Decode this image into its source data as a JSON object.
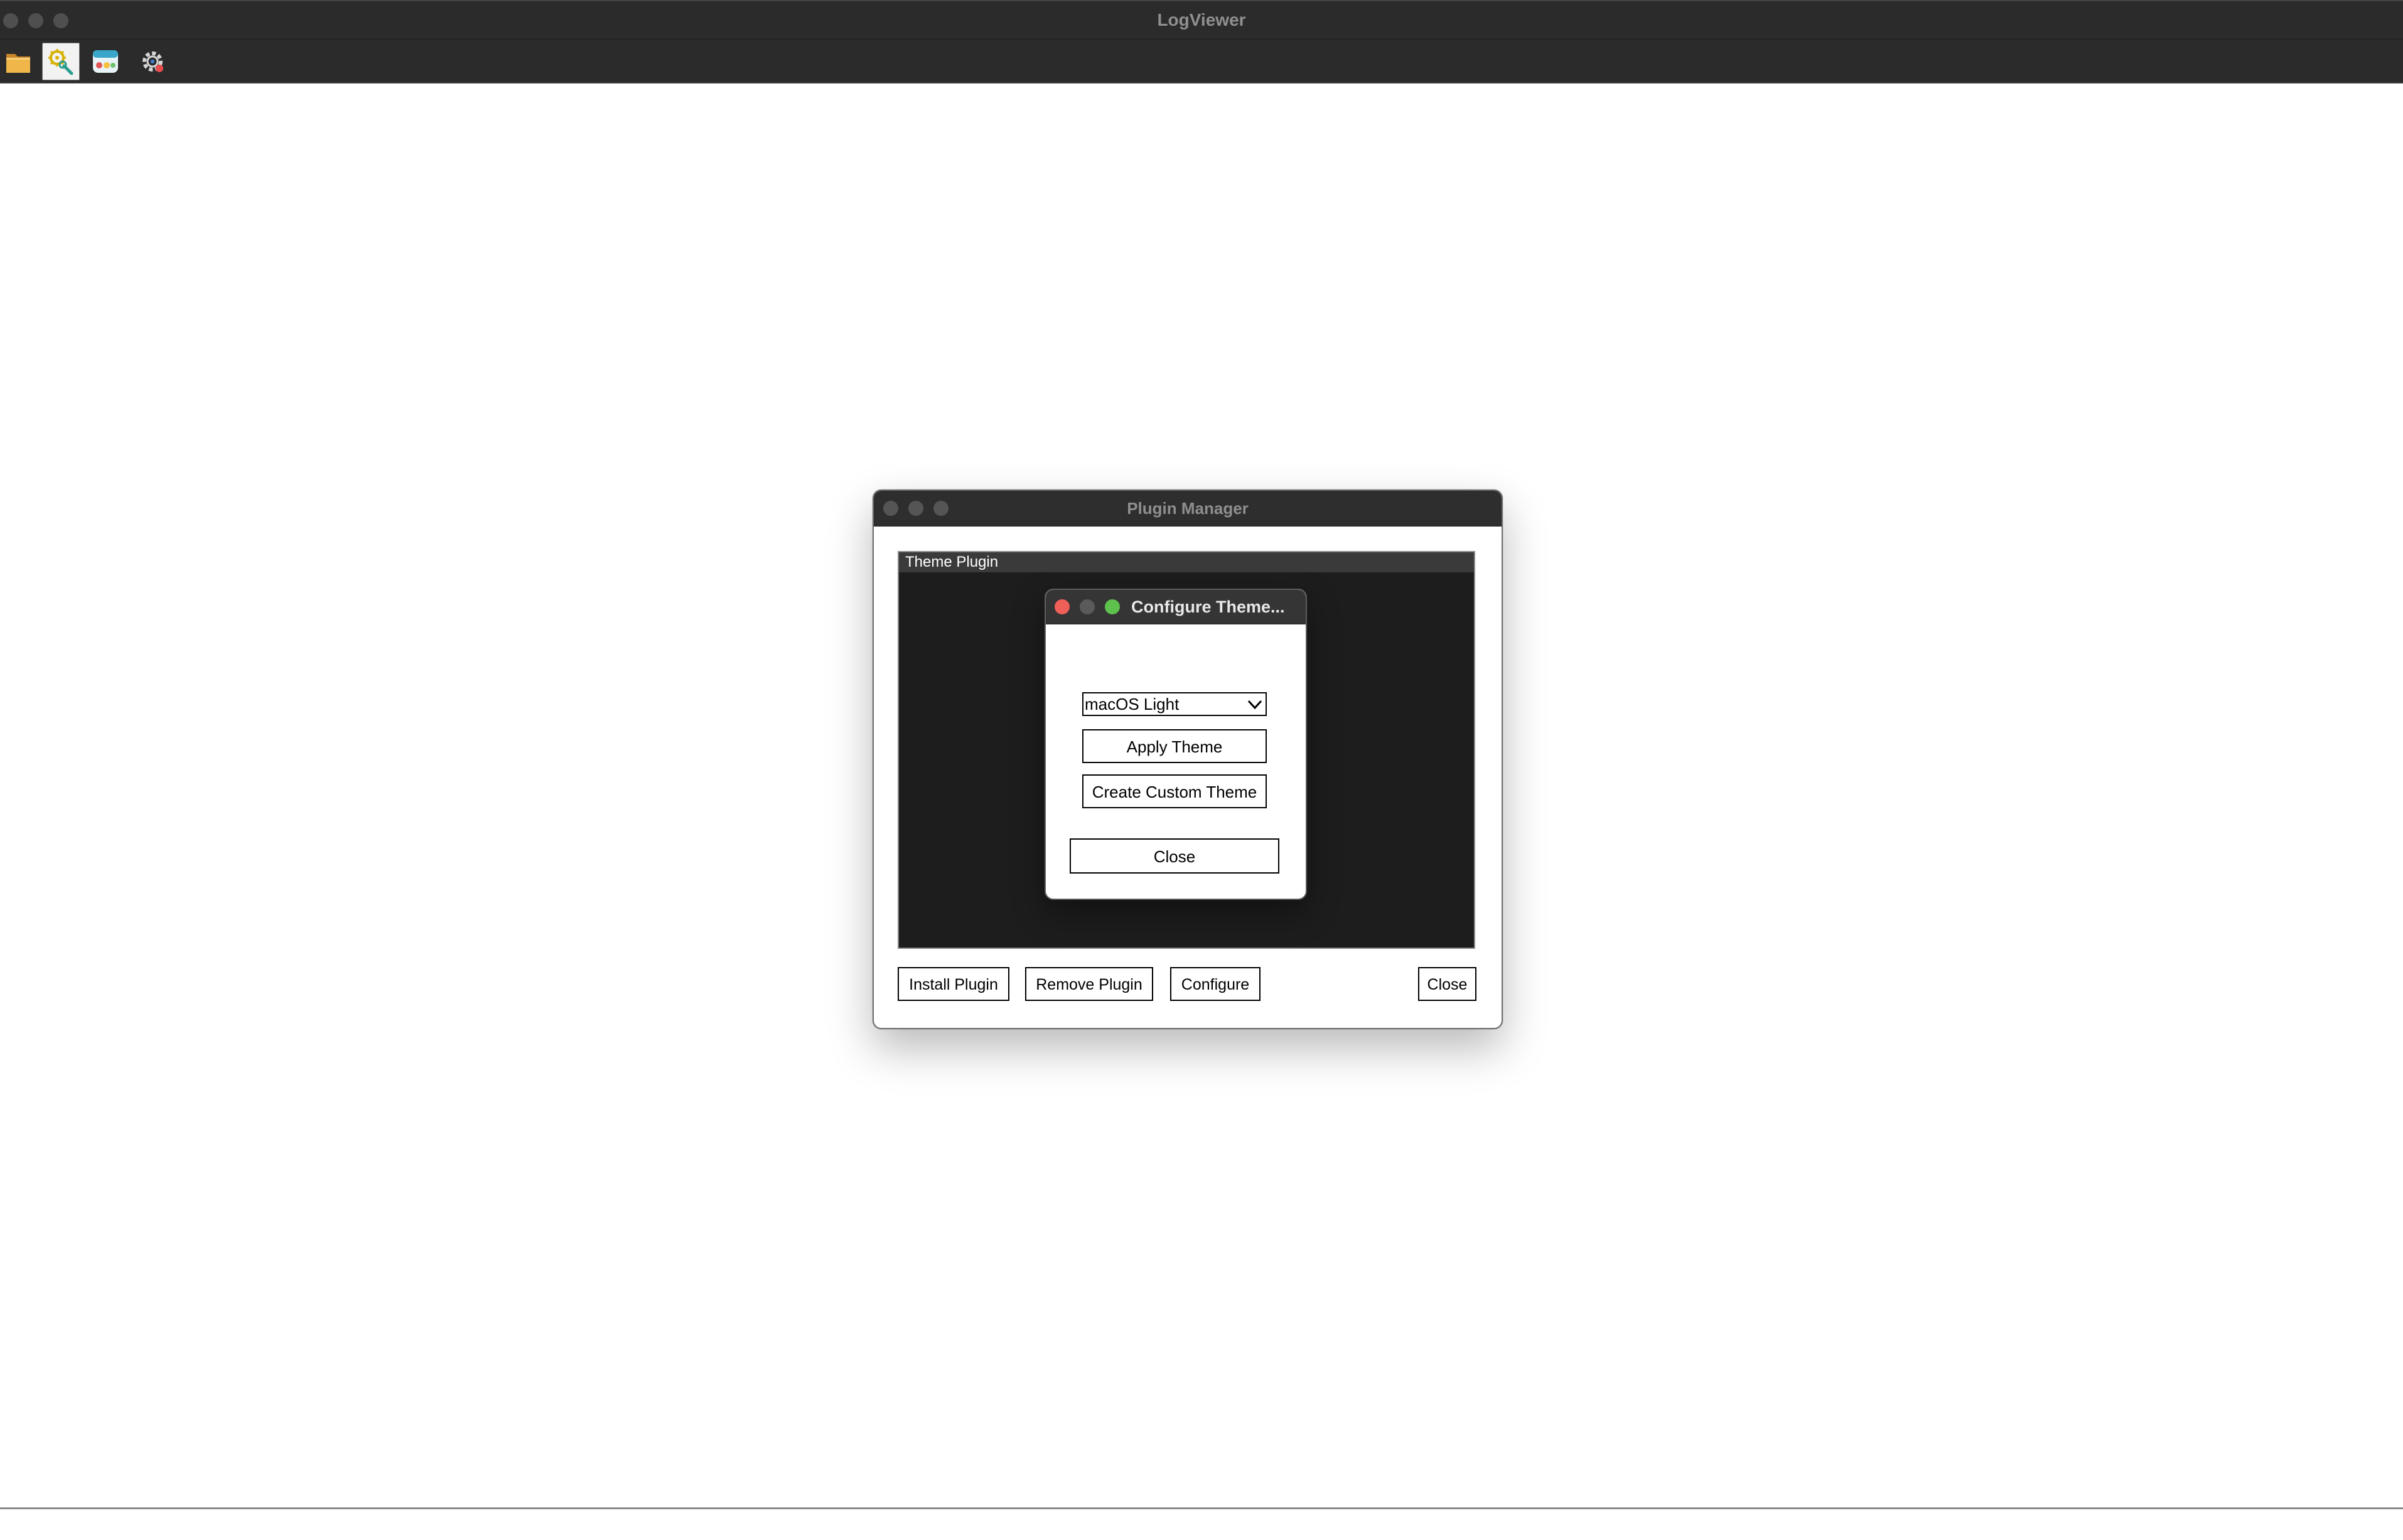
{
  "app": {
    "title": "LogViewer"
  },
  "toolbar": {
    "tools": [
      {
        "icon": "folder-icon",
        "label": "Open"
      },
      {
        "icon": "filter-settings-icon",
        "label": "Filter Settings"
      },
      {
        "icon": "theme-palette-icon",
        "label": "Themes"
      },
      {
        "icon": "plugin-gear-icon",
        "label": "Plugins"
      }
    ],
    "active_index": 1
  },
  "plugin_manager": {
    "title": "Plugin Manager",
    "plugins": [
      {
        "name": "Theme Plugin",
        "selected": true
      }
    ],
    "buttons": {
      "install": "Install Plugin",
      "remove": "Remove Plugin",
      "configure": "Configure",
      "close": "Close"
    }
  },
  "configure_theme": {
    "title": "Configure Theme...",
    "theme_select": {
      "value": "macOS Light"
    },
    "apply_label": "Apply Theme",
    "create_label": "Create Custom Theme",
    "close_label": "Close"
  },
  "colors": {
    "chrome": "#2b2b2b",
    "close": "#ee5f57",
    "minimize": "#5a5a5a",
    "maximize": "#5ec14e"
  }
}
